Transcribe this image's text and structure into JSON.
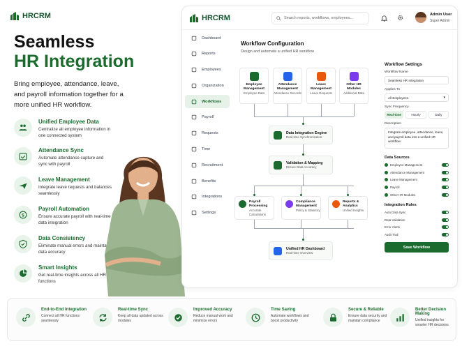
{
  "brand": {
    "name": "HRCRM"
  },
  "hero": {
    "line1": "Seamless",
    "line2": "HR Integration",
    "subtitle": "Bring employee, attendance, leave, and payroll information together for a more unified HR workflow."
  },
  "features": [
    {
      "title": "Unified Employee Data",
      "desc": "Centralize all employee information in one connected system",
      "icon": "people-icon"
    },
    {
      "title": "Attendance Sync",
      "desc": "Automate attendance capture and sync with payroll",
      "icon": "calendar-check-icon"
    },
    {
      "title": "Leave Management",
      "desc": "Integrate leave requests and balances seamlessly",
      "icon": "plane-icon"
    },
    {
      "title": "Payroll Automation",
      "desc": "Ensure accurate payroll with real-time data integration",
      "icon": "dollar-icon"
    },
    {
      "title": "Data Consistency",
      "desc": "Eliminate manual errors and maintain data accuracy",
      "icon": "shield-icon"
    },
    {
      "title": "Smart Insights",
      "desc": "Get real-time insights across all HR functions",
      "icon": "chart-icon"
    }
  ],
  "app": {
    "brand": "HRCRM",
    "search_placeholder": "Search reports, workflows, employees...",
    "user_name": "Admin User",
    "user_role": "Super Admin",
    "nav": [
      "Dashboard",
      "Reports",
      "Employees",
      "Organization",
      "Workflows",
      "Payroll",
      "Requests",
      "Time",
      "Recruitment",
      "Benefits",
      "Integrations",
      "Settings"
    ],
    "title": "Workflow Configuration",
    "subtitle": "Design and automate a unified HR workflow",
    "sources": [
      {
        "title": "Employee Management",
        "sub": "Employee Data",
        "color": "#1b6b2e"
      },
      {
        "title": "Attendance Management",
        "sub": "Attendance Records",
        "color": "#2563eb"
      },
      {
        "title": "Leave Management",
        "sub": "Leave Requests",
        "color": "#ea580c"
      },
      {
        "title": "Other HR Modules",
        "sub": "Additional Data",
        "color": "#7c3aed"
      }
    ],
    "engine": {
      "title": "Data Integration Engine",
      "sub": "Real-time Synchronization"
    },
    "validation": {
      "title": "Validation & Mapping",
      "sub": "Ensure Data Accuracy"
    },
    "outputs": [
      {
        "title": "Payroll Processing",
        "sub": "Accurate Calculations",
        "color": "#1b6b2e"
      },
      {
        "title": "Compliance Management",
        "sub": "Policy & Statutory",
        "color": "#7c3aed"
      },
      {
        "title": "Reports & Analytics",
        "sub": "Unified Insights",
        "color": "#ea580c"
      }
    ],
    "dashboard": {
      "title": "Unified HR Dashboard",
      "sub": "Real-time Overview"
    },
    "settings": {
      "title": "Workflow Settings",
      "name_label": "Workflow Name",
      "name_value": "Seamless HR Integration",
      "applies_label": "Applies To",
      "applies_value": "All Employees",
      "sync_label": "Sync Frequency",
      "sync_options": [
        "Real-time",
        "Hourly",
        "Daily"
      ],
      "desc_label": "Description",
      "desc_value": "Integrate employee, attendance, leave, and payroll data into a unified HR workflow.",
      "sources_title": "Data Sources",
      "sources": [
        "Employee Management",
        "Attendance Management",
        "Leave Management",
        "Payroll",
        "Other HR Modules"
      ],
      "rules_title": "Integration Rules",
      "rules": [
        "Auto Data Sync",
        "Data Validation",
        "Error Alerts",
        "Audit Trail"
      ],
      "save": "Save Workflow"
    }
  },
  "bottom": [
    {
      "title": "End-to-End Integration",
      "desc": "Connect all HR functions seamlessly",
      "icon": "link-icon"
    },
    {
      "title": "Real-time Sync",
      "desc": "Keep all data updated across modules",
      "icon": "sync-icon"
    },
    {
      "title": "Improved Accuracy",
      "desc": "Reduce manual work and minimize errors",
      "icon": "check-circle-icon"
    },
    {
      "title": "Time Saving",
      "desc": "Automate workflows and boost productivity",
      "icon": "clock-icon"
    },
    {
      "title": "Secure & Reliable",
      "desc": "Ensure data security and maintain compliance",
      "icon": "lock-icon"
    },
    {
      "title": "Better Decision Making",
      "desc": "Unified insights for smarter HR decisions",
      "icon": "bar-chart-icon"
    }
  ]
}
